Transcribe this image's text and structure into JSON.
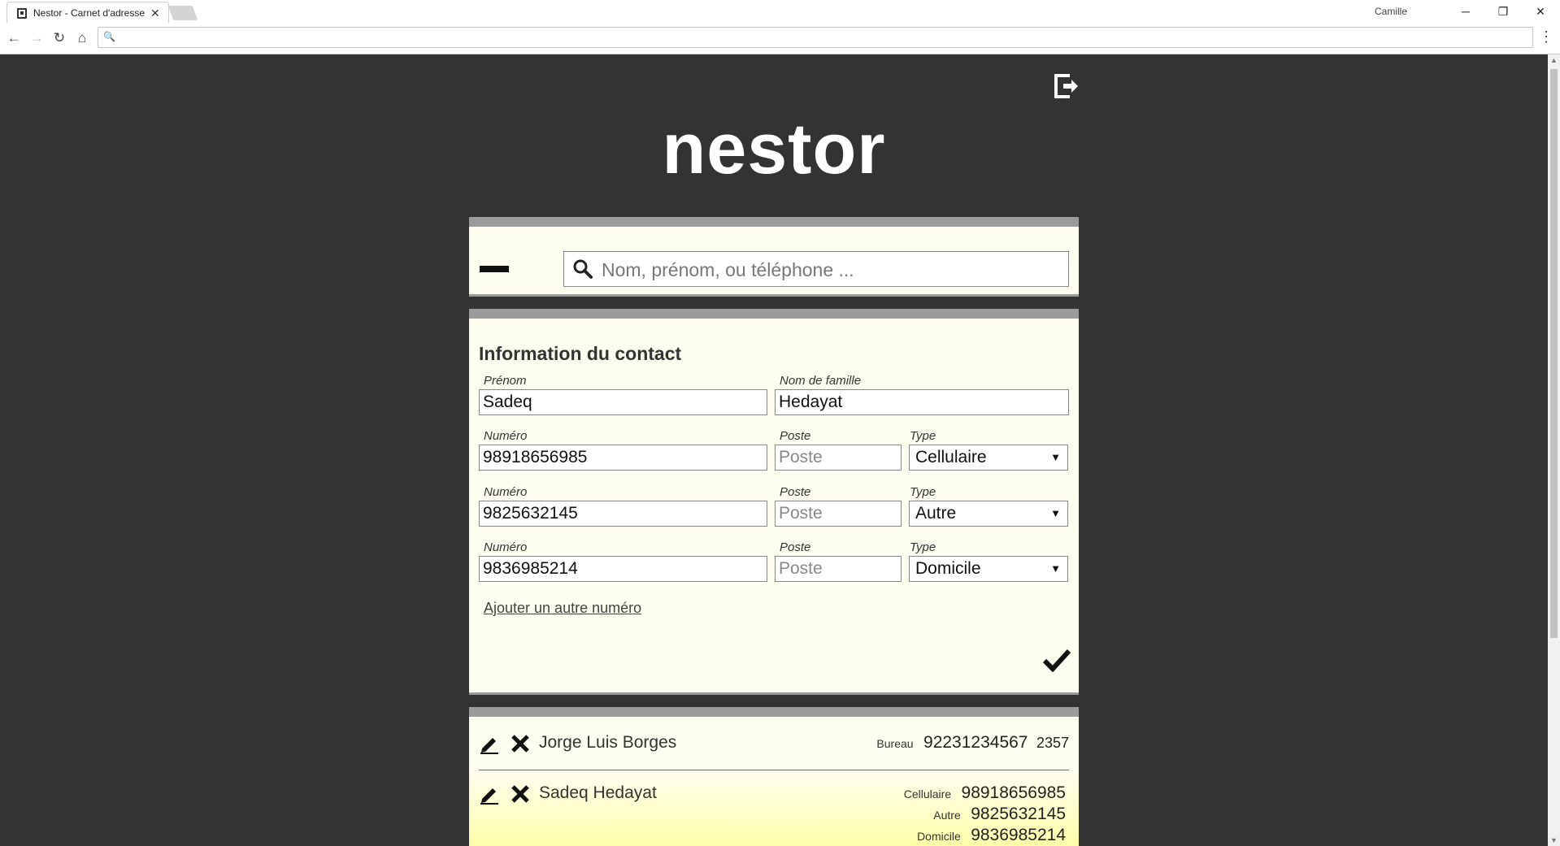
{
  "browser": {
    "tab_title": "Nestor - Carnet d'adresse",
    "tab_close": "✕",
    "profile": "Camille",
    "min": "─",
    "restore": "❐",
    "close": "✕",
    "back": "←",
    "forward": "→",
    "reload": "↻",
    "home": "⌂",
    "omnibox_icon": "🔍",
    "menu": "⋮"
  },
  "app": {
    "title": "nestor"
  },
  "search": {
    "placeholder": "Nom, prénom, ou téléphone ..."
  },
  "form": {
    "title": "Information du contact",
    "prenom_label": "Prénom",
    "prenom_value": "Sadeq",
    "nom_label": "Nom de famille",
    "nom_value": "Hedayat",
    "numero_label": "Numéro",
    "poste_label": "Poste",
    "poste_placeholder": "Poste",
    "type_label": "Type",
    "caret": "▼",
    "phones": [
      {
        "numero": "98918656985",
        "poste": "",
        "type": "Cellulaire"
      },
      {
        "numero": "9825632145",
        "poste": "",
        "type": "Autre"
      },
      {
        "numero": "9836985214",
        "poste": "",
        "type": "Domicile"
      }
    ],
    "add_number_link": "Ajouter un autre numéro"
  },
  "contacts": [
    {
      "name": "Jorge Luis Borges",
      "phones": [
        {
          "type": "Bureau",
          "number": "92231234567",
          "ext": "2357"
        }
      ]
    },
    {
      "name": "Sadeq Hedayat",
      "phones": [
        {
          "type": "Cellulaire",
          "number": "98918656985",
          "ext": ""
        },
        {
          "type": "Autre",
          "number": "9825632145",
          "ext": ""
        },
        {
          "type": "Domicile",
          "number": "9836985214",
          "ext": ""
        }
      ]
    }
  ],
  "colors": {
    "page_bg": "#333333",
    "card_bg": "#fefef0",
    "card_border": "#9b9b9b",
    "highlight": "#ffff9a"
  },
  "icons": [
    "logout-icon",
    "search-icon",
    "collapse-icon",
    "edit-icon",
    "delete-icon",
    "checkmark-icon"
  ]
}
